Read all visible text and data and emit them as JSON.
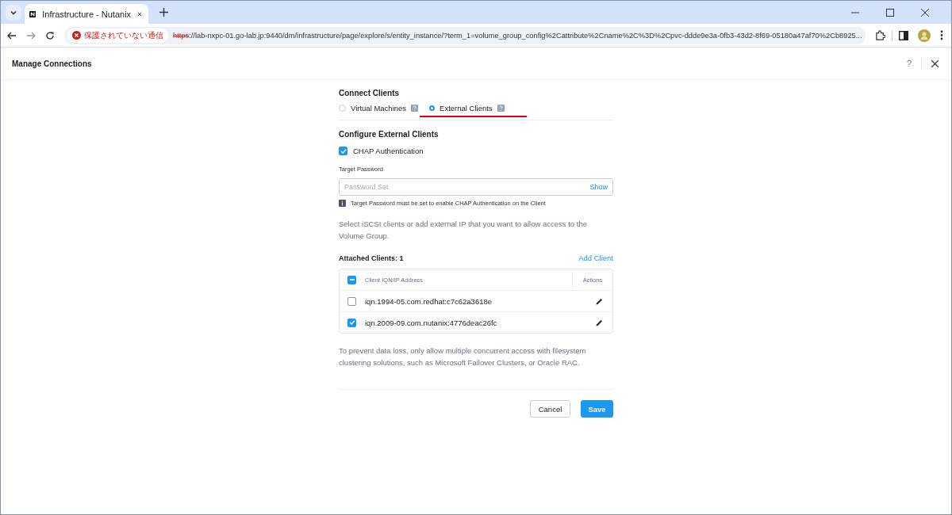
{
  "browser": {
    "tab_title": "Infrastructure - Nutanix",
    "security_label": "保護されていない通信",
    "url_scheme": "https",
    "url_rest": "://lab-nxpc-01.go-lab.jp:9440/dm/infrastructure/page/explore/s/entity_instance/?term_1=volume_group_config%2Cattribute%2Cname%2C%3D%2Cpvc-ddde9e3a-0fb3-43d2-8f69-05180a47af70%2Cb8925..."
  },
  "dialog": {
    "title": "Manage Connections",
    "help": "?"
  },
  "connect": {
    "heading": "Connect Clients",
    "options": [
      {
        "label": "Virtual Machines",
        "selected": false
      },
      {
        "label": "External Clients",
        "selected": true
      }
    ]
  },
  "configure": {
    "heading": "Configure External Clients",
    "chap": {
      "label": "CHAP Authentication",
      "checked": true
    },
    "password_label": "Target Password",
    "password_placeholder": "Password Set",
    "show": "Show",
    "note": "Target Password must be set to enable CHAP Authentication on the Client",
    "description": "Select iSCSI clients or add external IP that you want to allow access to the Volume Group."
  },
  "attached": {
    "heading": "Attached Clients: 1",
    "add": "Add Client",
    "columns": [
      "Client IQN/IP Address",
      "Actions"
    ],
    "select_all": {
      "indeterminate": true
    },
    "rows": [
      {
        "name": "iqn.1994-05.com.redhat:c7c62a3618e",
        "checked": false
      },
      {
        "name": "iqn.2009-09.com.nutanix:4776deac26fc",
        "checked": true
      }
    ]
  },
  "warning": "To prevent data loss, only allow multiple concurrent access with filesystem clustering solutions, such as Microsoft Failover Clusters, or Oracle RAC.",
  "buttons": {
    "cancel": "Cancel",
    "save": "Save"
  }
}
